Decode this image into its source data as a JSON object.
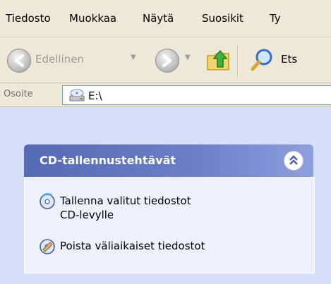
{
  "menu": {
    "items": [
      "Tiedosto",
      "Muokkaa",
      "Näytä",
      "Suosikit",
      "Ty"
    ]
  },
  "toolbar": {
    "back_label": "Edellinen",
    "search_label": "Ets"
  },
  "address": {
    "label": "Osoite",
    "value": "E:\\"
  },
  "task_panel": {
    "title": "CD-tallennustehtävät",
    "tasks": [
      {
        "line1": "Tallenna valitut tiedostot",
        "line2": "CD-levylle",
        "icon": "burn-cd-icon"
      },
      {
        "line1": "Poista väliaikaiset tiedostot",
        "icon": "delete-temp-files-icon"
      }
    ]
  },
  "colors": {
    "menu_bg": "#ece9d8",
    "pane_bg": "#d6dff7",
    "header_gradient_start": "#5669b5",
    "header_gradient_end": "#8e9fdd",
    "panel_body": "#eef1fb"
  }
}
